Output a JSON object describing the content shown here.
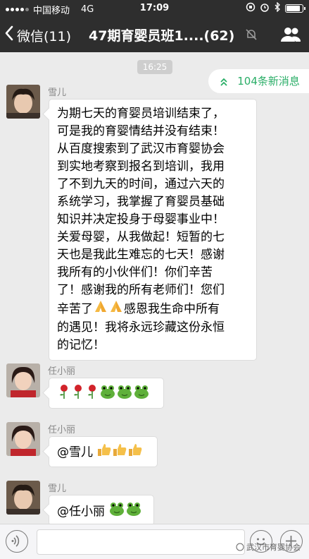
{
  "status_bar": {
    "carrier": "中国移动",
    "network": "4G",
    "time": "17:09",
    "battery_level": 0.9
  },
  "nav": {
    "back_label": "微信(11)",
    "title": "47期育婴员班1....(62)",
    "icons": [
      "chevron-left-icon",
      "mute-icon",
      "group-members-icon"
    ]
  },
  "chat": {
    "timestamp": "16:25",
    "new_messages_label": "104条新消息",
    "messages": [
      {
        "sender": "雪儿",
        "text": "为期七天的育婴员培训结束了，\n可是我的育婴情结并没有结束！\n从百度搜索到了武汉市育婴协会\n到实地考察到报名到培训，我用\n了不到九天的时间，通过六天的\n系统学习，我掌握了育婴员基础\n知识并决定投身于母婴事业中！\n关爱母婴，从我做起！短暂的七\n天也是我此生难忘的七天！感谢\n我所有的小伙伴们！你们辛苦\n了！感谢我的所有老师们！您们\n辛苦了",
        "text_after_emoji": "感恩我生命中所有\n的遇见！我将永远珍藏这份永恒\n的记忆！",
        "emoji": [
          "praying-hands",
          "praying-hands"
        ]
      },
      {
        "sender": "任小丽",
        "emoji": [
          "rose",
          "rose",
          "rose",
          "frog",
          "frog",
          "frog"
        ]
      },
      {
        "sender": "任小丽",
        "text": "@雪儿",
        "emoji": [
          "thumbs-up",
          "thumbs-up",
          "thumbs-up"
        ]
      },
      {
        "sender": "雪儿",
        "text": "@任小丽",
        "emoji": [
          "frog",
          "frog"
        ]
      }
    ]
  },
  "input_bar": {
    "placeholder": "",
    "icons": [
      "voice-icon",
      "emoji-face-icon",
      "plus-icon"
    ]
  },
  "watermark": "武汉市育婴协会",
  "colors": {
    "header_bg": "#2e2e2e",
    "chat_bg": "#ebebeb",
    "accent_green": "#2aae67"
  }
}
